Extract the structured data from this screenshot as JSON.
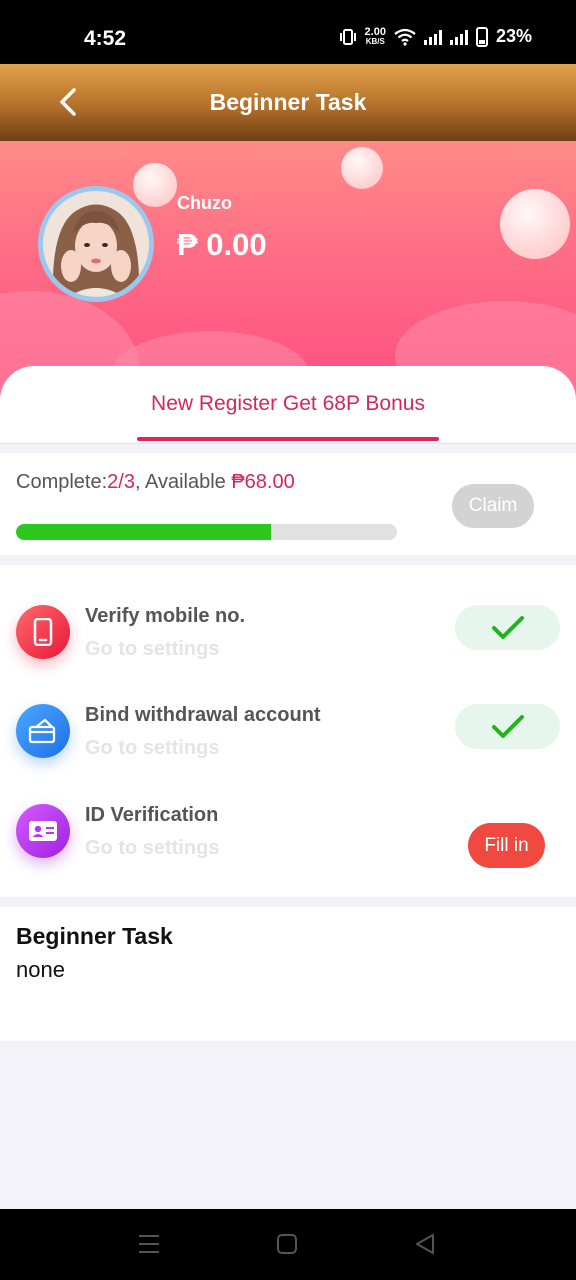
{
  "status_bar": {
    "time": "4:52",
    "speed_value": "2.00",
    "speed_unit": "KB/S",
    "battery": "23%",
    "icons": [
      "vibrate-icon",
      "wifi-icon",
      "signal-icon",
      "signal-icon",
      "battery-icon"
    ]
  },
  "header": {
    "title": "Beginner Task",
    "back_icon": "chevron-left-icon"
  },
  "profile": {
    "username": "Chuzo",
    "balance": "₱ 0.00"
  },
  "tabs": [
    {
      "label": "New Register Get 68P Bonus",
      "active": true
    }
  ],
  "progress": {
    "complete_prefix": "Complete:",
    "complete_value": "2/3",
    "available_prefix": ", Available ",
    "available_value": "₱68.00",
    "fraction": 0.67,
    "claim_label": "Claim"
  },
  "tasks": [
    {
      "title": "Verify mobile no.",
      "subtitle": "Go to settings",
      "icon": "phone-icon",
      "status": "done"
    },
    {
      "title": "Bind withdrawal account",
      "subtitle": "Go to settings",
      "icon": "card-icon",
      "status": "done"
    },
    {
      "title": "ID Verification",
      "subtitle": "Go to settings",
      "icon": "id-card-icon",
      "status": "pending",
      "action_label": "Fill in"
    }
  ],
  "info": {
    "title": "Beginner Task",
    "body": "none"
  },
  "nav": {
    "icons": [
      "menu-icon",
      "home-icon",
      "back-triangle-icon"
    ]
  },
  "colors": {
    "accent": "#d6265c",
    "progress": "#2cc71f",
    "fill_button": "#f0493f",
    "header_gold": "#b3702a"
  }
}
